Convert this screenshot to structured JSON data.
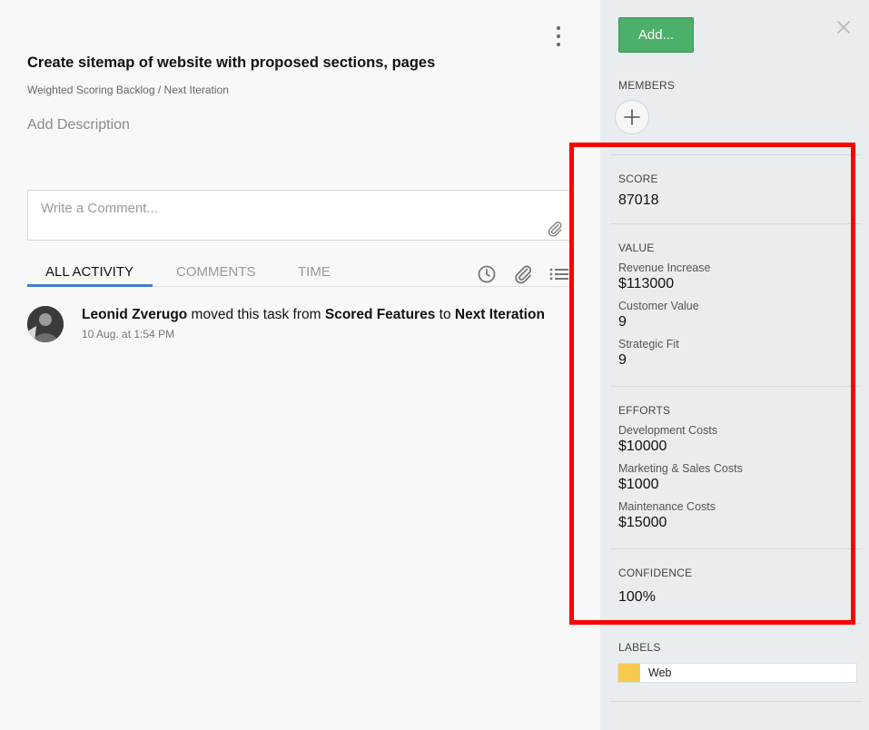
{
  "task": {
    "title": "Create sitemap of website with proposed sections, pages",
    "breadcrumb": "Weighted Scoring Backlog / Next Iteration",
    "add_description": "Add Description"
  },
  "comment": {
    "placeholder": "Write a Comment..."
  },
  "tabs": [
    {
      "label": "ALL ACTIVITY",
      "active": true
    },
    {
      "label": "COMMENTS",
      "active": false
    },
    {
      "label": "TIME",
      "active": false
    }
  ],
  "tab_icons": [
    "clock-icon",
    "paperclip-icon",
    "list-icon"
  ],
  "activity": [
    {
      "user": "Leonid Zverugo",
      "action": " moved this task from ",
      "from": "Scored Features",
      "connector": " to ",
      "to": "Next Iteration",
      "time": "10 Aug. at 1:54 PM"
    }
  ],
  "sidebar": {
    "add_button": "Add...",
    "members_label": "MEMBERS",
    "score_label": "SCORE",
    "score_value": "87018",
    "value_label": "VALUE",
    "value_fields": [
      {
        "label": "Revenue Increase",
        "value": "$113000"
      },
      {
        "label": "Customer Value",
        "value": "9"
      },
      {
        "label": "Strategic Fit",
        "value": "9"
      }
    ],
    "efforts_label": "EFFORTS",
    "efforts_fields": [
      {
        "label": "Development Costs",
        "value": "$10000"
      },
      {
        "label": "Marketing & Sales Costs",
        "value": "$1000"
      },
      {
        "label": "Maintenance Costs",
        "value": "$15000"
      }
    ],
    "confidence_label": "CONFIDENCE",
    "confidence_value": "100%",
    "labels_label": "LABELS",
    "labels": [
      {
        "name": "Web",
        "color": "#f6c94a"
      }
    ]
  },
  "colors": {
    "accent_tab": "#3f7fd0",
    "add_button": "#4caf6a",
    "highlight": "#ff0000"
  }
}
